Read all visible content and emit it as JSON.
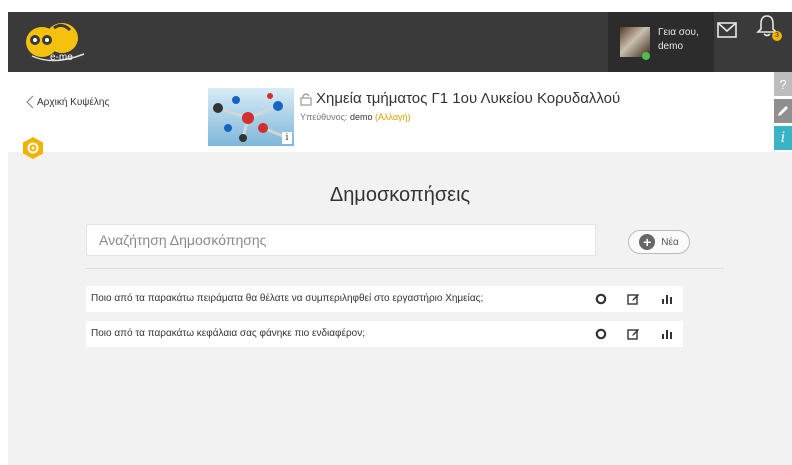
{
  "header": {
    "logo_text": "e-me",
    "greeting": "Γεια σου,",
    "username": "demo",
    "notification_count": "3"
  },
  "course": {
    "back_label": "Αρχική Κυψέλης",
    "title": "Χημεία τμήματος Γ1 1ου Λυκείου Κορυδαλλού",
    "owner_label": "Υπεύθυνος:",
    "owner_name": "demo",
    "change_label": "(Αλλαγή)",
    "thumb_info": "i"
  },
  "side_tools": {
    "help": "?",
    "info": "i"
  },
  "main": {
    "title": "Δημοσκοπήσεις",
    "search_placeholder": "Αναζήτηση Δημοσκόπησης",
    "new_label": "Νέα"
  },
  "polls": [
    {
      "question": "Ποιο από τα παρακάτω πειράματα θα θέλατε να συμπεριληφθεί στο εργαστήριο Χημείας;"
    },
    {
      "question": "Ποιο από τα παρακάτω κεφάλαια σας φάνηκε πιο ενδιαφέρον;"
    }
  ],
  "colors": {
    "topbar": "#3a3a3a",
    "accent_yellow": "#f0b400",
    "info_teal": "#3ab4c4",
    "status_online": "#4cc04a"
  },
  "icons": [
    "bee-logo-icon",
    "mail-icon",
    "bell-icon",
    "chevron-left-icon",
    "lock-icon",
    "gear-icon",
    "help-icon",
    "pencil-icon",
    "info-icon",
    "plus-icon",
    "circle-icon",
    "edit-icon",
    "bar-chart-icon"
  ]
}
